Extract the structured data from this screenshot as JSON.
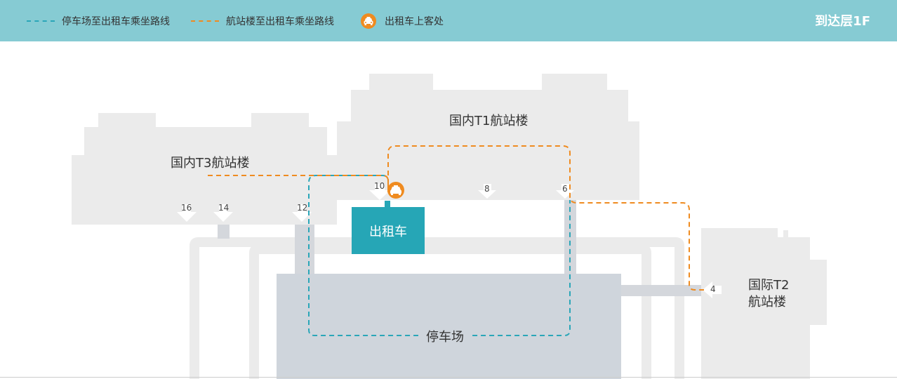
{
  "header": {
    "legend": [
      {
        "label": "停车场至出租车乘坐路线",
        "color": "#2aa6b8"
      },
      {
        "label": "航站楼至出租车乘坐路线",
        "color": "#ef8b20"
      },
      {
        "label": "出租车上客处",
        "icon": "taxi-icon",
        "color": "#ef8b20"
      }
    ],
    "floor": "到达层1F"
  },
  "map": {
    "terminals": {
      "t1": "国内T1航站楼",
      "t3": "国内T3航站楼",
      "t2_line1": "国际T2",
      "t2_line2": "航站楼"
    },
    "taxi_stand": "出租车",
    "parking": "停车场",
    "gates": [
      "16",
      "14",
      "12",
      "10",
      "8",
      "6",
      "4"
    ]
  },
  "colors": {
    "header_bg": "#86cbd3",
    "building": "#ebebeb",
    "parking_area": "#cfd5dc",
    "taxi_box": "#26a6b6",
    "parking_route": "#2aa6b8",
    "terminal_route": "#ef8b20"
  }
}
